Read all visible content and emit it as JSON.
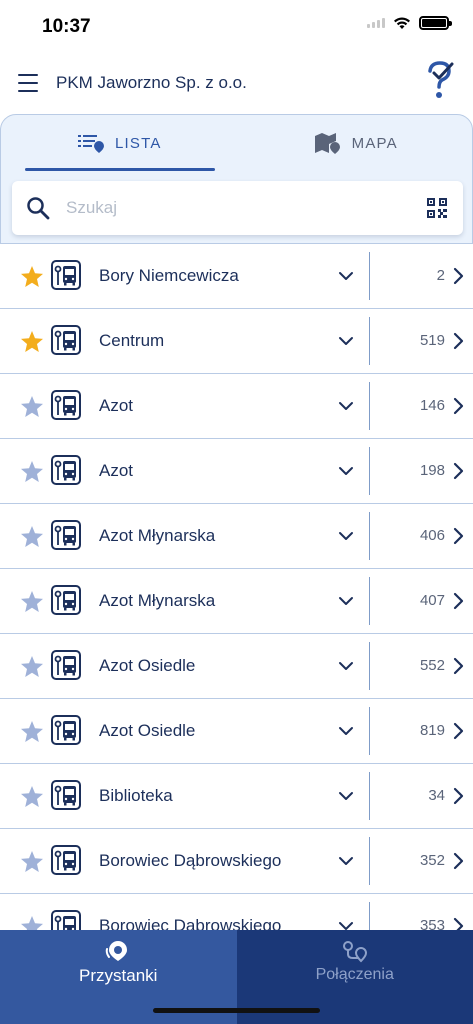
{
  "status_bar": {
    "time": "10:37"
  },
  "header": {
    "title": "PKM Jaworzno Sp. z o.o."
  },
  "tabs": [
    {
      "label": "LISTA",
      "active": true,
      "icon": "list-pin-icon"
    },
    {
      "label": "MAPA",
      "active": false,
      "icon": "map-pin-icon"
    }
  ],
  "search": {
    "placeholder": "Szukaj",
    "value": ""
  },
  "colors": {
    "accent": "#2e57a7",
    "favorite_star": "#f3ad1d",
    "inactive_star": "#9fb1d8",
    "nav_active": "#34589f",
    "nav_inactive": "#1b3878"
  },
  "stops": [
    {
      "name": "Bory Niemcewicza",
      "number": "2",
      "favorite": true
    },
    {
      "name": "Centrum",
      "number": "519",
      "favorite": true
    },
    {
      "name": "Azot",
      "number": "146",
      "favorite": false
    },
    {
      "name": "Azot",
      "number": "198",
      "favorite": false
    },
    {
      "name": "Azot Młynarska",
      "number": "406",
      "favorite": false
    },
    {
      "name": "Azot Młynarska",
      "number": "407",
      "favorite": false
    },
    {
      "name": "Azot Osiedle",
      "number": "552",
      "favorite": false
    },
    {
      "name": "Azot Osiedle",
      "number": "819",
      "favorite": false
    },
    {
      "name": "Biblioteka",
      "number": "34",
      "favorite": false
    },
    {
      "name": "Borowiec Dąbrowskiego",
      "number": "352",
      "favorite": false
    },
    {
      "name": "Borowiec Dąbrowskiego",
      "number": "353",
      "favorite": false
    }
  ],
  "bottom_nav": [
    {
      "label": "Przystanki",
      "active": true,
      "icon": "stop-pin-icon"
    },
    {
      "label": "Połączenia",
      "active": false,
      "icon": "route-icon"
    }
  ]
}
